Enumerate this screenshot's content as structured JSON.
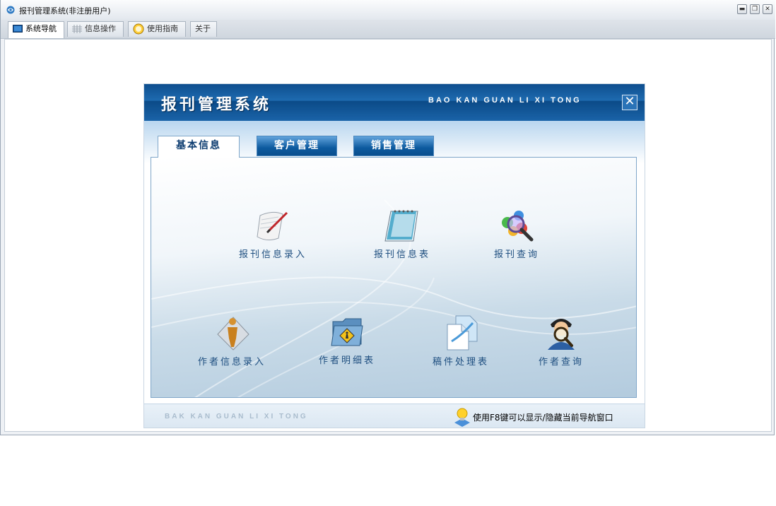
{
  "window": {
    "title": "报刊管理系统(非注册用户)",
    "controls": {
      "minimize": "▬",
      "restore": "❐",
      "close": "✕"
    }
  },
  "main_tabs": [
    {
      "label": "系统导航",
      "icon": "monitor-icon"
    },
    {
      "label": "信息操作",
      "icon": "grid-icon"
    },
    {
      "label": "使用指南",
      "icon": "help-icon"
    },
    {
      "label": "关于",
      "icon": ""
    }
  ],
  "panel": {
    "title": "报刊管理系统",
    "pinyin": "BAO KAN GUAN LI XI TONG",
    "close_label": "✕",
    "tabs": [
      "基本信息",
      "客户管理",
      "销售管理"
    ],
    "items_row1": [
      {
        "label": "报刊信息录入",
        "icon": "scroll-pen-icon"
      },
      {
        "label": "报刊信息表",
        "icon": "notepad-icon"
      },
      {
        "label": "报刊查询",
        "icon": "magnifier-icon"
      }
    ],
    "items_row2": [
      {
        "label": "作者信息录入",
        "icon": "person-icon"
      },
      {
        "label": "作者明细表",
        "icon": "folder-icon"
      },
      {
        "label": "稿件处理表",
        "icon": "document-icon"
      },
      {
        "label": "作者查询",
        "icon": "person-search-icon"
      }
    ],
    "footer": {
      "pinyin": "BAK KAN GUAN LI XI TONG",
      "hint": "使用F8键可以显示/隐藏当前导航窗口"
    }
  },
  "colors": {
    "header_blue": "#1e6bb0",
    "tab_blue": "#0d5a9f",
    "label_blue": "#1f4f80"
  }
}
